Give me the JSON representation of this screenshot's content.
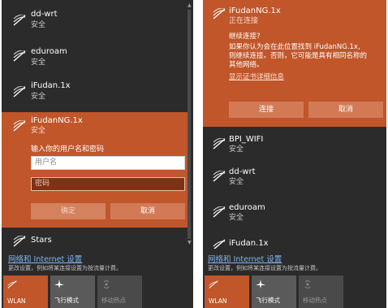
{
  "left_panel": {
    "networks": [
      {
        "name": "dd-wrt",
        "status": "安全"
      },
      {
        "name": "eduroam",
        "status": "安全"
      },
      {
        "name": "iFudan.1x",
        "status": "安全"
      },
      {
        "name": "Stars",
        "status": ""
      }
    ],
    "expanded_network": {
      "name": "iFudanNG.1x",
      "status": "安全",
      "prompt": "输入你的用户名和密码",
      "username_placeholder": "用户名",
      "password_placeholder": "密码",
      "ok_label": "确定",
      "cancel_label": "取消"
    },
    "settings": {
      "link": "网络和 Internet 设置",
      "desc": "更改设置，例如将某连接设置为按流量计费。"
    },
    "tiles": [
      {
        "label": "WLAN",
        "icon": "wifi-icon"
      },
      {
        "label": "飞行模式",
        "icon": "airplane-icon"
      },
      {
        "label": "移动热点",
        "icon": "hotspot-icon"
      }
    ]
  },
  "right_panel": {
    "expanded_network": {
      "name": "iFudanNG.1x",
      "status": "正在连接",
      "warning_title": "继续连接?",
      "warning_line1": "如果你认为会在此位置找到 iFudanNG.1x,",
      "warning_line2": "则继续连接。否则，它可能是具有相同名称的",
      "warning_line3": "其他网络。",
      "details_link": "显示证书详细信息",
      "connect_label": "连接",
      "cancel_label": "取消"
    },
    "networks": [
      {
        "name": "BPI_WIFI",
        "status": "安全"
      },
      {
        "name": "dd-wrt",
        "status": "安全"
      },
      {
        "name": "eduroam",
        "status": "安全"
      },
      {
        "name": "iFudan.1x",
        "status": ""
      }
    ],
    "settings": {
      "link": "网络和 Internet 设置",
      "desc": "更改设置，例如将某连接设置为按流量计费。"
    },
    "tiles": [
      {
        "label": "WLAN",
        "icon": "wifi-icon"
      },
      {
        "label": "飞行模式",
        "icon": "airplane-icon"
      },
      {
        "label": "移动热点",
        "icon": "hotspot-icon"
      }
    ]
  },
  "colors": {
    "panel_bg": "#2b2b2b",
    "accent": "#c1562a",
    "link": "#7db5f0"
  }
}
